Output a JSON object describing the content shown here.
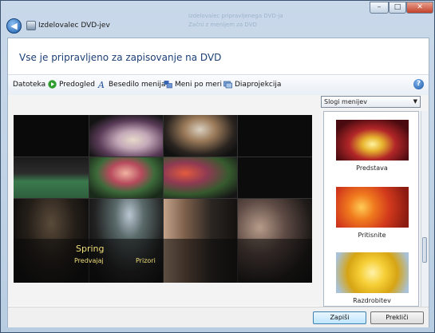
{
  "window": {
    "app_title": "Izdelovalec DVD-jev",
    "ghost_title_1": "Izdelovalec pripravljenega DVD-ja",
    "ghost_title_2": "Začni z menijem za DVD"
  },
  "heading": "Vse je pripravljeno za zapisovanje na DVD",
  "toolbar": {
    "datoteka": "Datoteka",
    "predogled": "Predogled",
    "besedilo": "Besedilo menija",
    "meni": "Meni po meri",
    "diaprojekcija": "Diaprojekcija",
    "help": "?"
  },
  "preview_menu": {
    "title": "Spring",
    "play": "Predvajaj",
    "scenes": "Prizori"
  },
  "styles": {
    "dropdown_value": "Slogi menijev",
    "items": [
      {
        "label": "Predstava",
        "icon": "stage-thumbnail"
      },
      {
        "label": "Pritisnite",
        "icon": "red-flower-thumbnail"
      },
      {
        "label": "Razdrobitev",
        "icon": "yellow-flower-thumbnail"
      }
    ]
  },
  "footer": {
    "burn": "Zapiši",
    "cancel": "Prekliči"
  },
  "colors": {
    "accent": "#1c3f75",
    "menu_text": "#f1de7a"
  }
}
